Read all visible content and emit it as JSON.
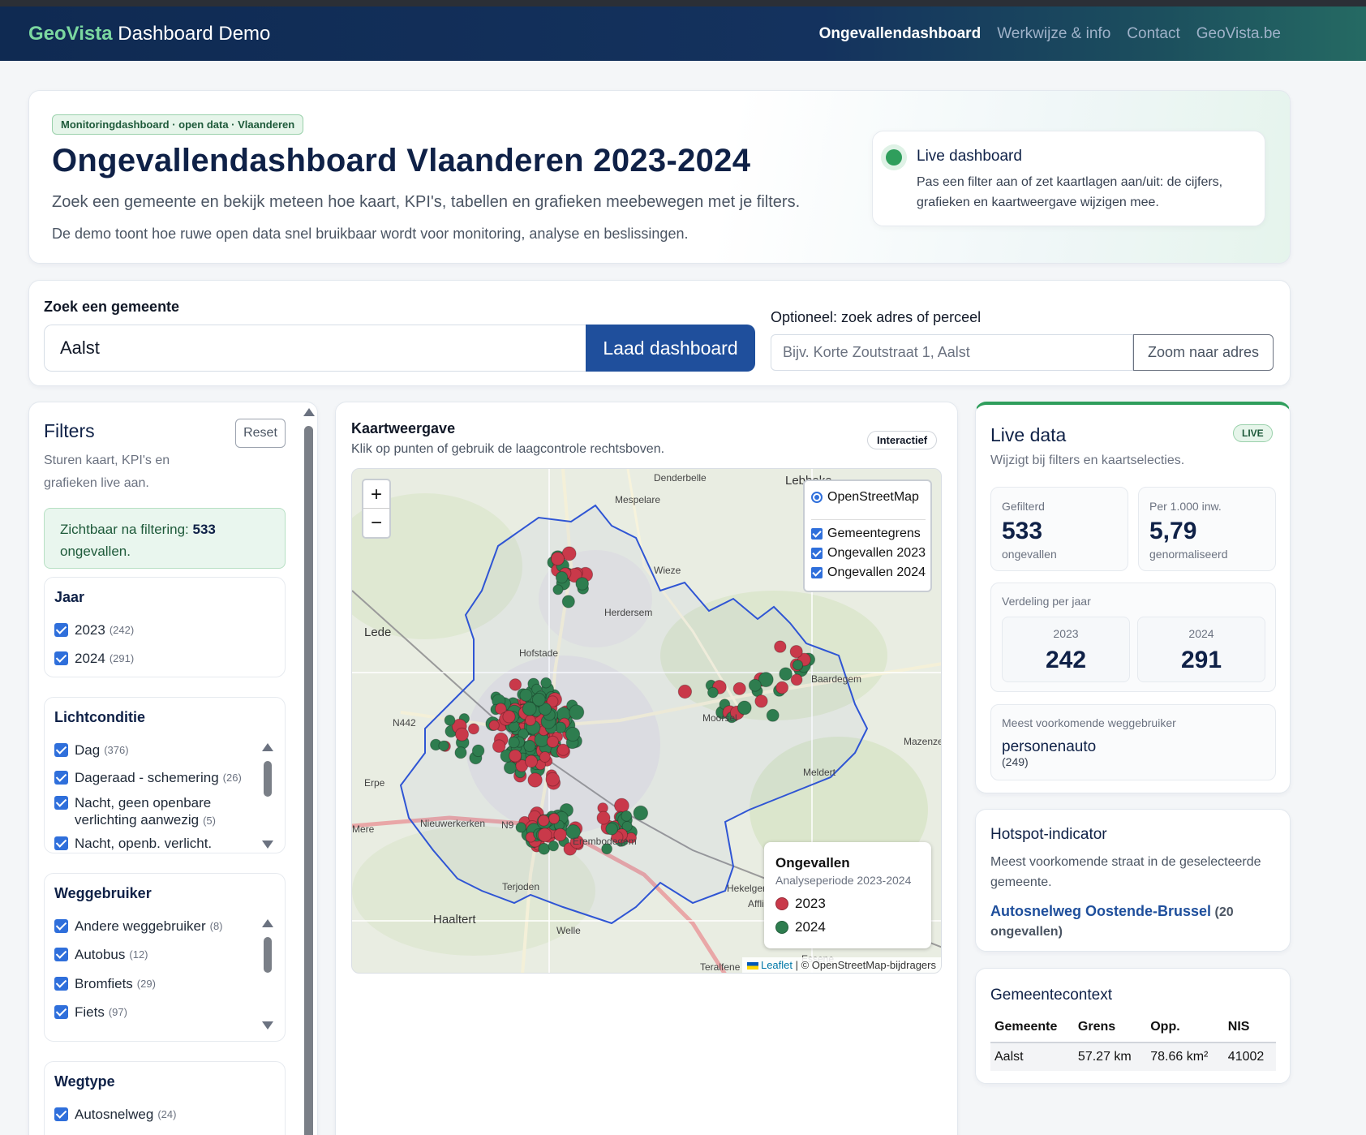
{
  "nav": {
    "brand_strong": "GeoVista",
    "brand_rest": " Dashboard Demo",
    "links": [
      "Ongevallendashboard",
      "Werkwijze & info",
      "Contact",
      "GeoVista.be"
    ]
  },
  "hero": {
    "badge": "Monitoringdashboard · open data · Vlaanderen",
    "title": "Ongevallendashboard Vlaanderen 2023-2024",
    "subtitle": "Zoek een gemeente en bekijk meteen hoe kaart, KPI's, tabellen en grafieken meebewegen met je filters.",
    "subtitle2": "De demo toont hoe ruwe open data snel bruikbaar wordt voor monitoring, analyse en beslissingen.",
    "live_title": "Live dashboard",
    "live_text": "Pas een filter aan of zet kaartlagen aan/uit: de cijfers, grafieken en kaartweergave wijzigen mee."
  },
  "search": {
    "label": "Zoek een gemeente",
    "value": "Aalst",
    "button": "Laad dashboard",
    "address_label": "Optioneel: zoek adres of perceel",
    "address_placeholder": "Bijv. Korte Zoutstraat 1, Aalst",
    "address_button": "Zoom naar adres"
  },
  "filters": {
    "title": "Filters",
    "reset": "Reset",
    "subtitle": "Sturen kaart, KPI's en grafieken live aan.",
    "visible_prefix": "Zichtbaar na filtering:",
    "visible_count": "533",
    "visible_suffix": "ongevallen.",
    "groups": [
      {
        "title": "Jaar",
        "items": [
          {
            "label": "2023",
            "count": "(242)"
          },
          {
            "label": "2024",
            "count": "(291)"
          }
        ]
      },
      {
        "title": "Lichtconditie",
        "items": [
          {
            "label": "Dag",
            "count": "(376)"
          },
          {
            "label": "Dageraad - schemering",
            "count": "(26)"
          },
          {
            "label": "Nacht, geen openbare verlichting aanwezig",
            "count": "(5)"
          },
          {
            "label": "Nacht, openb. verlicht.",
            "count": ""
          }
        ]
      },
      {
        "title": "Weggebruiker",
        "items": [
          {
            "label": "Andere weggebruiker",
            "count": "(8)"
          },
          {
            "label": "Autobus",
            "count": "(12)"
          },
          {
            "label": "Bromfiets",
            "count": "(29)"
          },
          {
            "label": "Fiets",
            "count": "(97)"
          }
        ]
      },
      {
        "title": "Wegtype",
        "items": [
          {
            "label": "Autosnelweg",
            "count": "(24)"
          }
        ]
      }
    ]
  },
  "map": {
    "title": "Kaartweergave",
    "subtitle": "Klik op punten of gebruik de laagcontrole rechtsboven.",
    "badge": "Interactief",
    "zoom_in": "+",
    "zoom_out": "−",
    "base_layer": "OpenStreetMap",
    "overlays": [
      "Gemeentegrens",
      "Ongevallen 2023",
      "Ongevallen 2024"
    ],
    "legend_title": "Ongevallen",
    "legend_sub": "Analyseperiode 2023-2024",
    "legend_items": [
      {
        "label": "2023",
        "color": "#c9394a"
      },
      {
        "label": "2024",
        "color": "#2e7d4f"
      }
    ],
    "attrib_leaflet": "Leaflet",
    "attrib_rest": " | © OpenStreetMap-bijdragers",
    "place_labels": [
      "Denderbelle",
      "Lebbeke",
      "Mespelare",
      "Wieze",
      "Herdersem",
      "Lede",
      "Hofstade",
      "Baardegem",
      "N442",
      "Moorsel",
      "Mazenzele",
      "Erpe",
      "Meldert",
      "Nieuwerkerken",
      "Mere",
      "Erembodegem",
      "Hekelgem",
      "Affligem",
      "Terjoden",
      "Haaltert",
      "Welle",
      "Essene",
      "Teralfene",
      "N9"
    ],
    "colors": {
      "y2023": "#c9394a",
      "y2024": "#2e7d4f",
      "boundary": "#2f55d4"
    }
  },
  "live": {
    "title": "Live data",
    "badge": "LIVE",
    "subtitle": "Wijzigt bij filters en kaartselecties.",
    "kpis": [
      {
        "label": "Gefilterd",
        "value": "533",
        "sub": "ongevallen"
      },
      {
        "label": "Per 1.000 inw.",
        "value": "5,79",
        "sub": "genormaliseerd"
      }
    ],
    "year_label": "Verdeling per jaar",
    "years": [
      {
        "label": "2023",
        "value": "242"
      },
      {
        "label": "2024",
        "value": "291"
      }
    ],
    "mode_label": "Meest voorkomende weggebruiker",
    "mode_value": "personenauto",
    "mode_count": "(249)"
  },
  "hotspot": {
    "title": "Hotspot-indicator",
    "text": "Meest voorkomende straat in de geselecteerde gemeente.",
    "street": "Autosnelweg Oostende-Brussel",
    "count": " (20 ongevallen)"
  },
  "context": {
    "title": "Gemeentecontext",
    "headers": [
      "Gemeente",
      "Grens",
      "Opp.",
      "NIS"
    ],
    "row": [
      "Aalst",
      "57.27 km",
      "78.66 km²",
      "41002"
    ]
  }
}
